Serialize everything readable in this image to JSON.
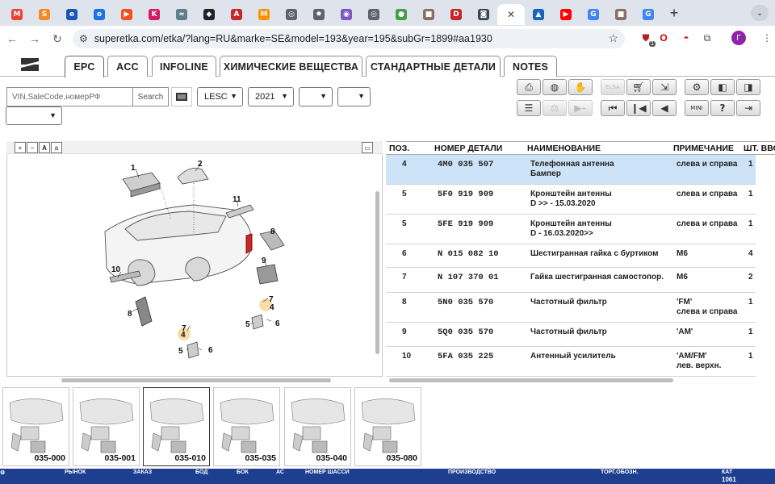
{
  "browser": {
    "url": "superetka.com/etka/?lang=RU&marke=SE&model=193&year=195&subGr=1899#aa1930",
    "tabs": [
      {
        "icon": "gmail-icon",
        "glyph": "M",
        "color": "#ea4335"
      },
      {
        "icon": "orange-swirl-icon",
        "glyph": "S",
        "color": "#f28c28"
      },
      {
        "icon": "blue-shield-icon",
        "glyph": "e",
        "color": "#1a56b3"
      },
      {
        "icon": "chat-bubble-icon",
        "glyph": "o",
        "color": "#1a73e8"
      },
      {
        "icon": "orange-play-icon",
        "glyph": "▶",
        "color": "#f4511e"
      },
      {
        "icon": "k-icon",
        "glyph": "K",
        "color": "#d81b60"
      },
      {
        "icon": "cloud-icon",
        "glyph": "≈",
        "color": "#607d8b"
      },
      {
        "icon": "cube-icon",
        "glyph": "◆",
        "color": "#222222"
      },
      {
        "icon": "red-circle-icon",
        "glyph": "A",
        "color": "#c62828"
      },
      {
        "icon": "orange-m-icon",
        "glyph": "M",
        "color": "#ff8f00"
      },
      {
        "icon": "globe-icon",
        "glyph": "◎",
        "color": "#5f6368"
      },
      {
        "icon": "gear-tab-icon",
        "glyph": "✹",
        "color": "#5f6368"
      },
      {
        "icon": "eye-icon",
        "glyph": "◉",
        "color": "#7e57c2"
      },
      {
        "icon": "globe-icon",
        "glyph": "◎",
        "color": "#5f6368"
      },
      {
        "icon": "toggle-icon",
        "glyph": "●",
        "color": "#43a047"
      },
      {
        "icon": "bag-icon",
        "glyph": "■",
        "color": "#8d6e63"
      },
      {
        "icon": "d-icon",
        "glyph": "D",
        "color": "#c62828"
      },
      {
        "icon": "camera-icon",
        "glyph": "◙",
        "color": "#37474f"
      },
      {
        "icon": "active-tab",
        "glyph": "✕",
        "color": "#ffffff"
      },
      {
        "icon": "ship-icon",
        "glyph": "▲",
        "color": "#1565c0"
      },
      {
        "icon": "youtube-icon",
        "glyph": "▶",
        "color": "#ff0000"
      },
      {
        "icon": "google-icon",
        "glyph": "G",
        "color": "#4285f4"
      },
      {
        "icon": "bag-icon",
        "glyph": "■",
        "color": "#8d6e63"
      },
      {
        "icon": "google-icon",
        "glyph": "G",
        "color": "#4285f4"
      }
    ],
    "extension_badge": "1",
    "avatar_letter": "Г"
  },
  "app": {
    "tabs": [
      "EPC",
      "ACC",
      "INFOLINE",
      "ХИМИЧЕСКИЕ ВЕЩЕСТВА",
      "СТАНДАРТНЫЕ ДЕТАЛИ",
      "NOTES"
    ],
    "active_tab": "EPC",
    "search_placeholder": "VIN,SaleCode,номерРФ",
    "search_button": "Search",
    "selects": {
      "market": "LESC",
      "year": "2021",
      "s3": "",
      "s4": "",
      "s5": ""
    },
    "tool_icons": [
      "print-icon",
      "disc-icon",
      "handshake-icon",
      "elsa-icon",
      "cart-icon",
      "cart-out-icon",
      "settings-icon",
      "book-left-icon",
      "book-right-icon",
      "list-icon",
      "scale-icon",
      "play-dash-icon",
      "first-icon",
      "prev-group-icon",
      "prev-icon",
      "mini-icon",
      "help-icon",
      "exit-icon"
    ],
    "elsa_label": "ELSA",
    "mini_label": "MINI"
  },
  "diagram": {
    "callouts": [
      "1",
      "2",
      "11",
      "8",
      "9",
      "10",
      "8",
      "7",
      "4",
      "5",
      "6",
      "7",
      "4",
      "5",
      "6"
    ]
  },
  "table": {
    "headers": [
      "ПОЗ.",
      "НОМЕР ДЕТАЛИ",
      "НАИМЕНОВАНИЕ",
      "ПРИМЕЧАНИЕ",
      "ШТ. ВВО"
    ],
    "rows": [
      {
        "pos": "4",
        "part": "4M0  035  507",
        "name1": "Телефонная антенна",
        "name2": "Бампер",
        "note1": "слева и справа",
        "note2": "",
        "qty": "1"
      },
      {
        "pos": "5",
        "part": "5F0  919  909",
        "name1": "Кронштейн антенны",
        "name2": "D            >> - 15.03.2020",
        "note1": "слева и справа",
        "note2": "",
        "qty": "1"
      },
      {
        "pos": "5",
        "part": "5FE  919  909",
        "name1": "Кронштейн антенны",
        "name2": "D - 16.03.2020>>",
        "note1": "слева и справа",
        "note2": "",
        "qty": "1"
      },
      {
        "pos": "6",
        "part": "N    015  082  10",
        "name1": "Шестигранная гайка с буртиком",
        "name2": "",
        "note1": "M6",
        "note2": "",
        "qty": "4"
      },
      {
        "pos": "7",
        "part": "N    107  370  01",
        "name1": "Гайка шестигранная самостопор.",
        "name2": "",
        "note1": "M6",
        "note2": "",
        "qty": "2"
      },
      {
        "pos": "8",
        "part": "5N0  035  570",
        "name1": "Частотный фильтр",
        "name2": "",
        "note1": "'FM'",
        "note2": "слева и справа",
        "qty": "1"
      },
      {
        "pos": "9",
        "part": "5Q0  035  570",
        "name1": "Частотный фильтр",
        "name2": "",
        "note1": "'AM'",
        "note2": "",
        "qty": "1"
      },
      {
        "pos": "10",
        "part": "5FA  035  225",
        "name1": "Антенный усилитель",
        "name2": "",
        "note1": "'AM/FM'",
        "note2": "лев. верхн.",
        "qty": "1"
      }
    ]
  },
  "thumbnails": [
    "035-000",
    "035-001",
    "035-010",
    "035-035",
    "035-040",
    "035-080"
  ],
  "active_thumbnail": "035-010",
  "statusbar": [
    "РЫНОК",
    "ЗАКАЗ",
    "БОД",
    "БОК",
    "АС",
    "НОМЕР ШАССИ",
    "ПРОИЗВОДСТВО",
    "ТОРГ.ОБОЗН.",
    "КАТ",
    "1061"
  ]
}
